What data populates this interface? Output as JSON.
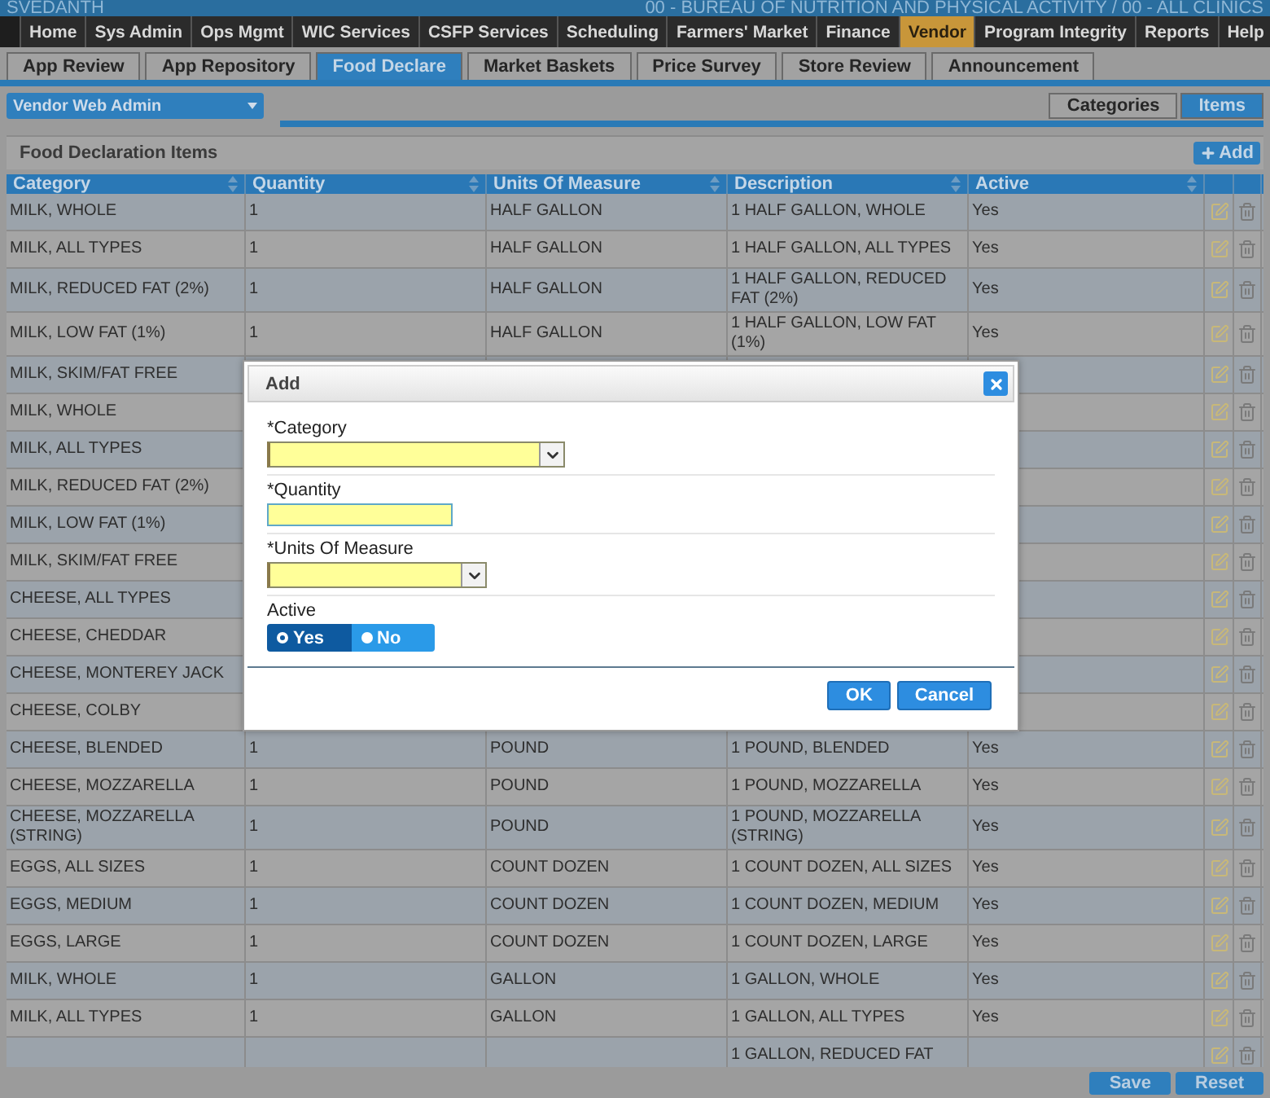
{
  "header": {
    "user": "SVEDANTH",
    "context": "00 - BUREAU OF NUTRITION AND PHYSICAL ACTIVITY / 00 - ALL CLINICS"
  },
  "menu": [
    {
      "label": "Home",
      "selected": false
    },
    {
      "label": "Sys Admin",
      "selected": false
    },
    {
      "label": "Ops Mgmt",
      "selected": false
    },
    {
      "label": "WIC Services",
      "selected": false
    },
    {
      "label": "CSFP Services",
      "selected": false
    },
    {
      "label": "Scheduling",
      "selected": false
    },
    {
      "label": "Farmers' Market",
      "selected": false
    },
    {
      "label": "Finance",
      "selected": false
    },
    {
      "label": "Vendor",
      "selected": true
    },
    {
      "label": "Program Integrity",
      "selected": false
    },
    {
      "label": "Reports",
      "selected": false
    },
    {
      "label": "Help",
      "selected": false
    }
  ],
  "tabs": [
    {
      "label": "App Review",
      "selected": false
    },
    {
      "label": "App Repository",
      "selected": false
    },
    {
      "label": "Food Declare",
      "selected": true
    },
    {
      "label": "Market Baskets",
      "selected": false
    },
    {
      "label": "Price Survey",
      "selected": false
    },
    {
      "label": "Store Review",
      "selected": false
    },
    {
      "label": "Announcement",
      "selected": false
    }
  ],
  "role_select": {
    "value": "Vendor Web Admin"
  },
  "view_tabs": [
    {
      "label": "Categories",
      "selected": false
    },
    {
      "label": "Items",
      "selected": true
    }
  ],
  "section": {
    "title": "Food Declaration Items",
    "add_button": "Add"
  },
  "table": {
    "columns": [
      "Category",
      "Quantity",
      "Units Of Measure",
      "Description",
      "Active"
    ],
    "rows": [
      {
        "category": "MILK, WHOLE",
        "quantity": "1",
        "units": "HALF GALLON",
        "description": "1 HALF GALLON, WHOLE",
        "active": "Yes"
      },
      {
        "category": "MILK, ALL TYPES",
        "quantity": "1",
        "units": "HALF GALLON",
        "description": "1 HALF GALLON, ALL TYPES",
        "active": "Yes"
      },
      {
        "category": "MILK, REDUCED FAT (2%)",
        "quantity": "1",
        "units": "HALF GALLON",
        "description": "1 HALF GALLON, REDUCED FAT (2%)",
        "active": "Yes"
      },
      {
        "category": "MILK, LOW FAT (1%)",
        "quantity": "1",
        "units": "HALF GALLON",
        "description": "1 HALF GALLON, LOW FAT (1%)",
        "active": "Yes"
      },
      {
        "category": "MILK, SKIM/FAT FREE"
      },
      {
        "category": "MILK, WHOLE"
      },
      {
        "category": "MILK, ALL TYPES"
      },
      {
        "category": "MILK, REDUCED FAT (2%)"
      },
      {
        "category": "MILK, LOW FAT (1%)"
      },
      {
        "category": "MILK, SKIM/FAT FREE"
      },
      {
        "category": "CHEESE, ALL TYPES"
      },
      {
        "category": "CHEESE, CHEDDAR"
      },
      {
        "category": "CHEESE, MONTEREY JACK"
      },
      {
        "category": "CHEESE, COLBY"
      },
      {
        "category": "CHEESE, BLENDED",
        "quantity": "1",
        "units": "POUND",
        "description": "1 POUND, BLENDED",
        "active": "Yes"
      },
      {
        "category": "CHEESE, MOZZARELLA",
        "quantity": "1",
        "units": "POUND",
        "description": "1 POUND, MOZZARELLA",
        "active": "Yes"
      },
      {
        "category": "CHEESE, MOZZARELLA (STRING)",
        "quantity": "1",
        "units": "POUND",
        "description": "1 POUND, MOZZARELLA (STRING)",
        "active": "Yes"
      },
      {
        "category": "EGGS, ALL SIZES",
        "quantity": "1",
        "units": "COUNT DOZEN",
        "description": "1 COUNT DOZEN, ALL SIZES",
        "active": "Yes"
      },
      {
        "category": "EGGS, MEDIUM",
        "quantity": "1",
        "units": "COUNT DOZEN",
        "description": "1 COUNT DOZEN, MEDIUM",
        "active": "Yes"
      },
      {
        "category": "EGGS, LARGE",
        "quantity": "1",
        "units": "COUNT DOZEN",
        "description": "1 COUNT DOZEN, LARGE",
        "active": "Yes"
      },
      {
        "category": "MILK, WHOLE",
        "quantity": "1",
        "units": "GALLON",
        "description": "1 GALLON, WHOLE",
        "active": "Yes"
      },
      {
        "category": "MILK, ALL TYPES",
        "quantity": "1",
        "units": "GALLON",
        "description": "1 GALLON, ALL TYPES",
        "active": "Yes"
      },
      {
        "description": "1 GALLON, REDUCED FAT"
      }
    ]
  },
  "dialog": {
    "title": "Add",
    "fields": [
      {
        "kind": "select",
        "label": "*Category"
      },
      {
        "kind": "text",
        "label": "*Quantity"
      },
      {
        "kind": "select",
        "label": "*Units Of Measure"
      },
      {
        "kind": "toggle",
        "label": "Active",
        "options": [
          {
            "label": "Yes",
            "selected": true
          },
          {
            "label": "No",
            "selected": false
          }
        ]
      }
    ],
    "buttons": [
      "OK",
      "Cancel"
    ]
  },
  "footer_buttons": [
    "Save",
    "Reset"
  ]
}
